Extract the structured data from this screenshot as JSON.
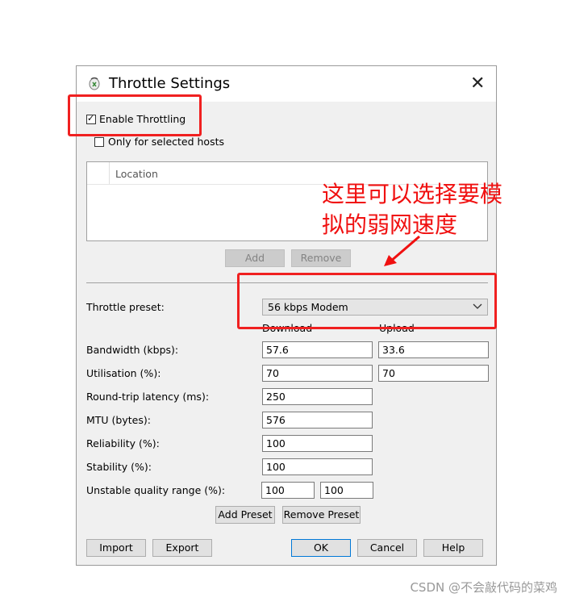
{
  "dialog": {
    "title": "Throttle Settings",
    "close": "✕",
    "enable_label": "Enable Throttling",
    "enable_checked": true,
    "selected_hosts_label": "Only for selected hosts",
    "selected_hosts_checked": false,
    "list": {
      "column": "Location"
    },
    "add_button": "Add",
    "remove_button": "Remove",
    "preset_label": "Throttle preset:",
    "preset_value": "56 kbps Modem",
    "col_download": "Download",
    "col_upload": "Upload",
    "rows": {
      "bandwidth": {
        "label": "Bandwidth (kbps):",
        "download": "57.6",
        "upload": "33.6"
      },
      "utilisation": {
        "label": "Utilisation (%):",
        "download": "70",
        "upload": "70"
      },
      "latency": {
        "label": "Round-trip latency (ms):",
        "value": "250"
      },
      "mtu": {
        "label": "MTU (bytes):",
        "value": "576"
      },
      "reliability": {
        "label": "Reliability (%):",
        "value": "100"
      },
      "stability": {
        "label": "Stability (%):",
        "value": "100"
      },
      "unstable": {
        "label": "Unstable quality range (%):",
        "min": "100",
        "max": "100"
      }
    },
    "add_preset_button": "Add Preset",
    "remove_preset_button": "Remove Preset",
    "import_button": "Import",
    "export_button": "Export",
    "ok_button": "OK",
    "cancel_button": "Cancel",
    "help_button": "Help"
  },
  "annotation": {
    "line1": "这里可以选择要模",
    "line2": "拟的弱网速度",
    "color": "#f01010"
  },
  "watermark": "CSDN @不会敲代码的菜鸡"
}
